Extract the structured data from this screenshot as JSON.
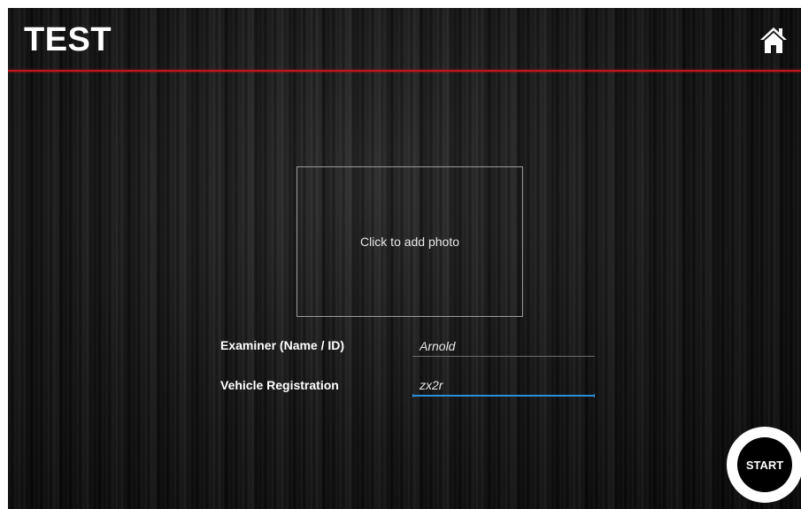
{
  "header": {
    "title": "TEST",
    "home_icon": "home-icon"
  },
  "photo": {
    "label": "Click to add photo"
  },
  "form": {
    "examiner": {
      "label": "Examiner (Name / ID)",
      "value": "Arnold"
    },
    "vehicle": {
      "label": "Vehicle Registration",
      "value": "zx2r"
    }
  },
  "actions": {
    "start_label": "START"
  },
  "colors": {
    "accent_red": "#c0161b",
    "focus_blue": "#2a8fd6",
    "background": "#0d0d0d"
  }
}
